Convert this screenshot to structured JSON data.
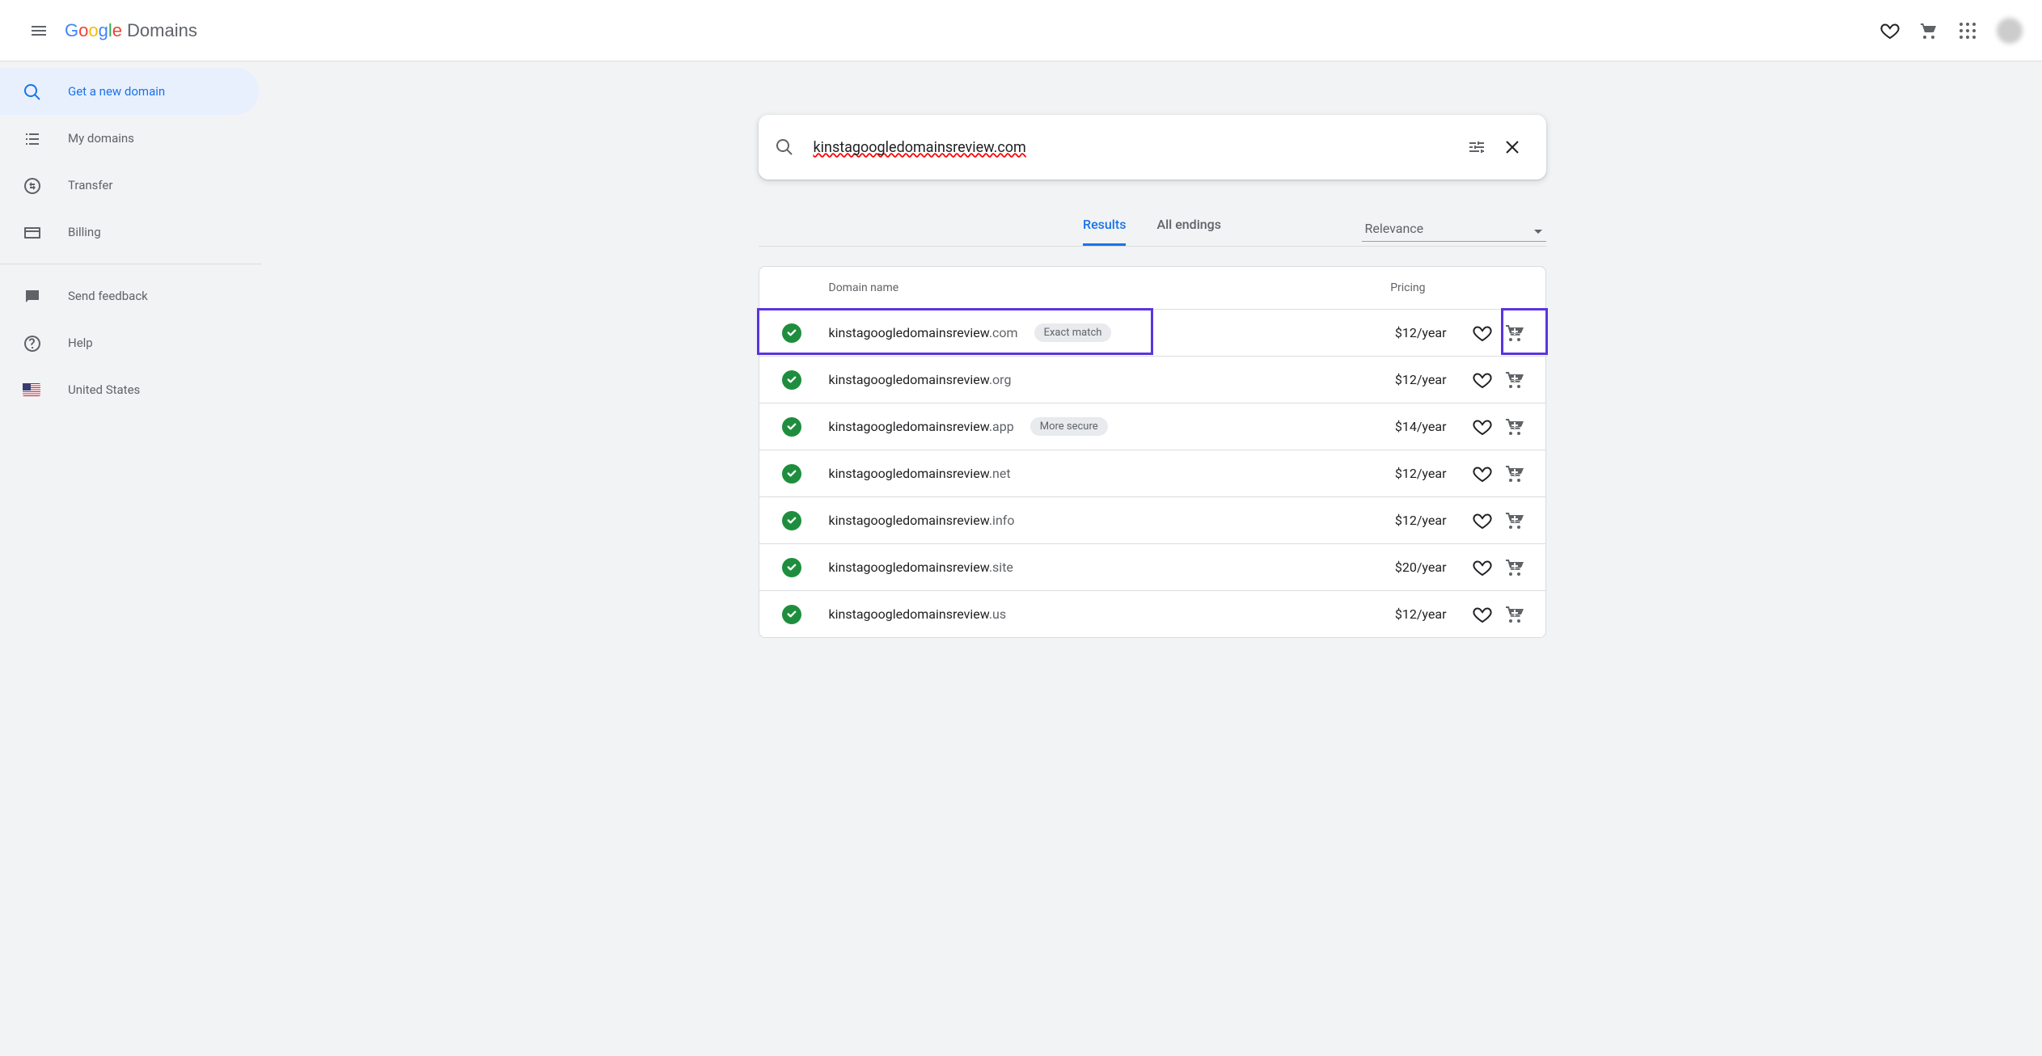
{
  "logo_sub": "Domains",
  "header": {},
  "sidebar": {
    "items": [
      {
        "label": "Get a new domain"
      },
      {
        "label": "My domains"
      },
      {
        "label": "Transfer"
      },
      {
        "label": "Billing"
      },
      {
        "label": "Send feedback"
      },
      {
        "label": "Help"
      },
      {
        "label": "United States"
      }
    ]
  },
  "search": {
    "query": "kinstagoogledomainsreview.com"
  },
  "tabs": {
    "results": "Results",
    "all_endings": "All endings"
  },
  "sort": {
    "label": "Relevance"
  },
  "table": {
    "domain_header": "Domain name",
    "price_header": "Pricing"
  },
  "chips": {
    "exact": "Exact match",
    "secure": "More secure"
  },
  "rows": [
    {
      "base": "kinstagoogledomainsreview",
      "tld": ".com",
      "price": "$12/year",
      "chip": "exact",
      "highlight": true
    },
    {
      "base": "kinstagoogledomainsreview",
      "tld": ".org",
      "price": "$12/year"
    },
    {
      "base": "kinstagoogledomainsreview",
      "tld": ".app",
      "price": "$14/year",
      "chip": "secure"
    },
    {
      "base": "kinstagoogledomainsreview",
      "tld": ".net",
      "price": "$12/year"
    },
    {
      "base": "kinstagoogledomainsreview",
      "tld": ".info",
      "price": "$12/year"
    },
    {
      "base": "kinstagoogledomainsreview",
      "tld": ".site",
      "price": "$20/year"
    },
    {
      "base": "kinstagoogledomainsreview",
      "tld": ".us",
      "price": "$12/year"
    }
  ]
}
